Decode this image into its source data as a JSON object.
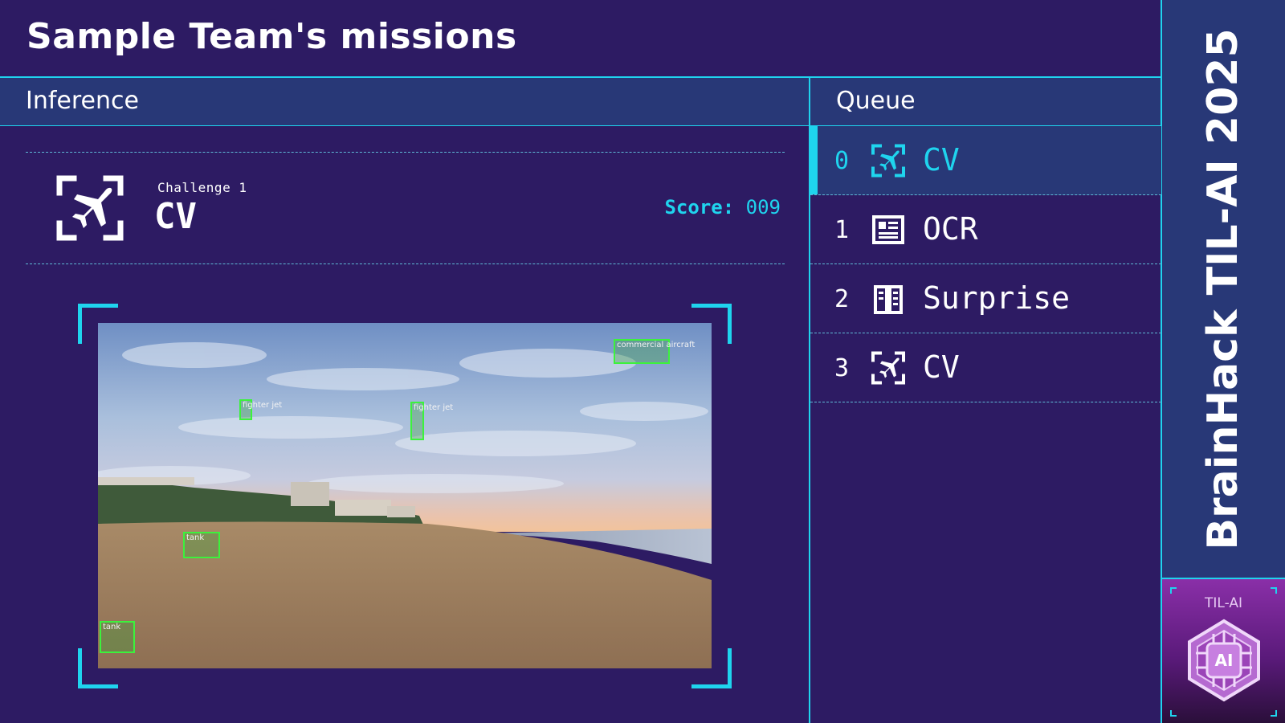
{
  "header": {
    "title": "Sample Team's missions"
  },
  "inference": {
    "section_title": "Inference",
    "challenge": {
      "label": "Challenge 1",
      "name": "CV",
      "icon": "airplane-scan-icon",
      "score_label": "Score:",
      "score_value": "009"
    },
    "detections": [
      {
        "label": "commercial aircraft"
      },
      {
        "label": "fighter jet"
      },
      {
        "label": "fighter jet"
      },
      {
        "label": "tank"
      },
      {
        "label": "tank"
      }
    ]
  },
  "queue": {
    "section_title": "Queue",
    "items": [
      {
        "index": "0",
        "icon": "airplane-scan-icon",
        "label": "CV",
        "active": true
      },
      {
        "index": "1",
        "icon": "newspaper-icon",
        "label": "OCR",
        "active": false
      },
      {
        "index": "2",
        "icon": "book-icon",
        "label": "Surprise",
        "active": false
      },
      {
        "index": "3",
        "icon": "airplane-scan-icon",
        "label": "CV",
        "active": false
      }
    ]
  },
  "side_banner": {
    "title": "BrainHack TIL-AI 2025"
  },
  "logo": {
    "text": "TIL-AI",
    "badge_text": "AI"
  },
  "colors": {
    "background": "#2d1b63",
    "panel": "#283877",
    "accent": "#1fd4ee",
    "detection": "#3cf23c"
  }
}
